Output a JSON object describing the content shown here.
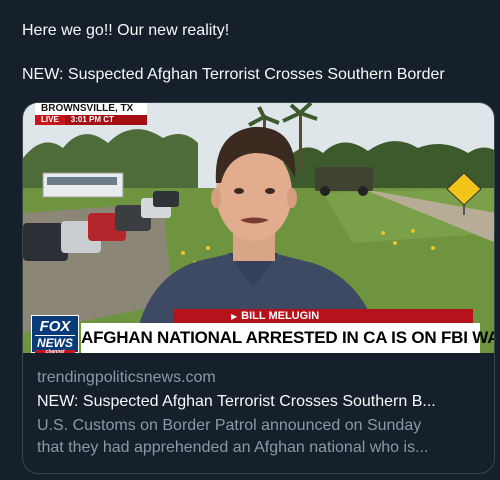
{
  "post": {
    "line1": "Here we go!! Our new reality!",
    "line2": "NEW: Suspected Afghan Terrorist Crosses Southern Border"
  },
  "card": {
    "media": {
      "location": "BROWNSVILLE, TX",
      "live_label": "LIVE",
      "time": "3:01 PM CT",
      "reporter": "BILL MELUGIN",
      "headline": "AFGHAN NATIONAL ARRESTED IN CA IS ON FBI WATCHLIST",
      "logo_line1": "FOX",
      "logo_line2": "NEWS",
      "logo_line3": "channel"
    },
    "domain": "trendingpoliticsnews.com",
    "title": "NEW: Suspected Afghan Terrorist Crosses Southern B...",
    "description_line1": "U.S. Customs on Border Patrol announced on Sunday",
    "description_line2": "that they had apprehended an Afghan national who is..."
  },
  "colors": {
    "background": "#15202b",
    "text": "#f7f9f9",
    "muted": "#8b98a5",
    "border": "#38444d",
    "fox_red": "#b5121b",
    "fox_blue": "#0a3a7a"
  }
}
